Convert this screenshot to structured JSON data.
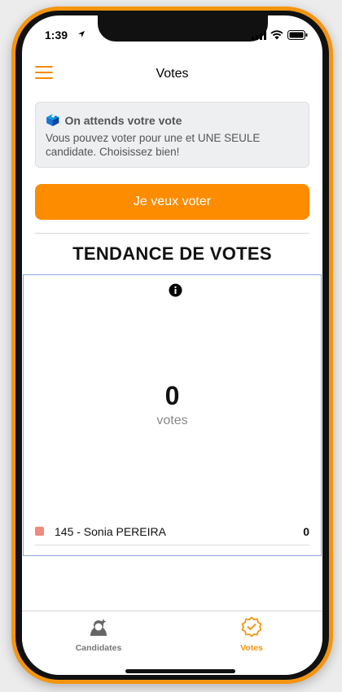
{
  "status": {
    "time": "1:39"
  },
  "header": {
    "title": "Votes"
  },
  "notice": {
    "emoji": "🗳️",
    "title": "On attends votre vote",
    "text": "Vous pouvez voter pour une et UNE SEULE candidate. Choisissez bien!"
  },
  "vote_button": {
    "label": "Je veux voter"
  },
  "trend": {
    "title": "TENDANCE DE VOTES",
    "total": "0",
    "total_label": "votes",
    "legend": [
      {
        "label": "145 - Sonia PEREIRA",
        "value": "0",
        "color": "#f08a7e"
      }
    ]
  },
  "tabs": [
    {
      "label": "Candidates",
      "icon": "candidate-icon",
      "active": false
    },
    {
      "label": "Votes",
      "icon": "vote-badge-icon",
      "active": true
    }
  ],
  "colors": {
    "accent": "#fd8c00",
    "frame": "#f5950f"
  }
}
